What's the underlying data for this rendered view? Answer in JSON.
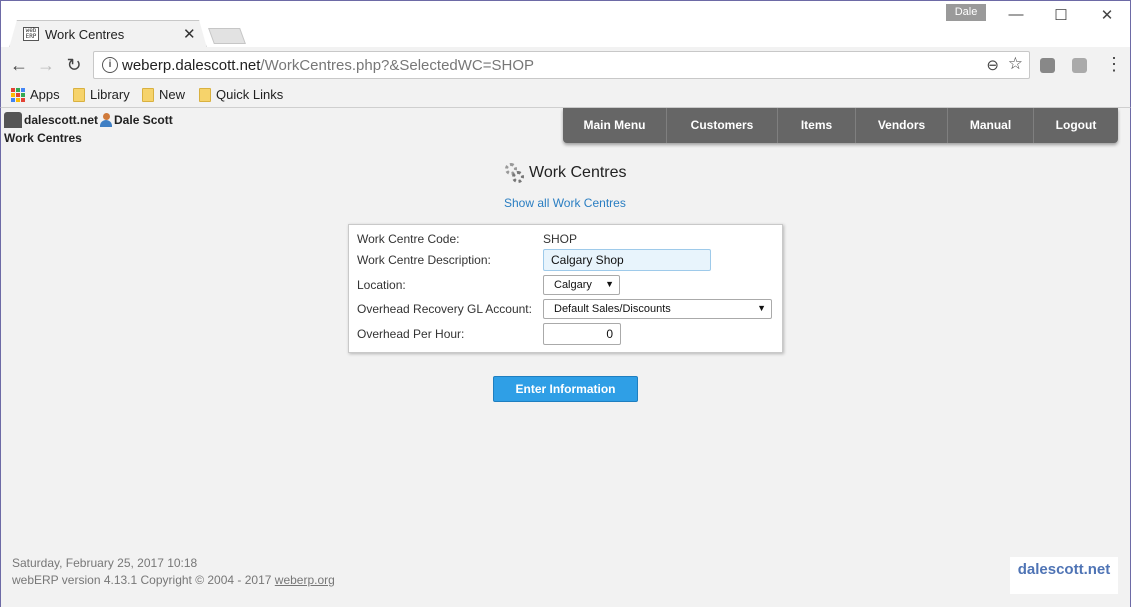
{
  "browser": {
    "tab_title": "Work Centres",
    "tab_favicon_text": "web ERP",
    "user_chip": "Dale",
    "url_host": "weberp.dalescott.net",
    "url_path": "/WorkCentres.php?&SelectedWC=SHOP",
    "bookmarks": [
      "Apps",
      "Library",
      "New",
      "Quick Links"
    ]
  },
  "header": {
    "company": "dalescott.net",
    "user": "Dale Scott",
    "breadcrumb": "Work Centres",
    "menu": [
      "Main Menu",
      "Customers",
      "Items",
      "Vendors",
      "Manual",
      "Logout"
    ]
  },
  "main": {
    "title": "Work Centres",
    "show_all_link": "Show all Work Centres",
    "form": {
      "code_label": "Work Centre Code:",
      "code_value": "SHOP",
      "description_label": "Work Centre Description:",
      "description_value": "Calgary Shop",
      "location_label": "Location:",
      "location_value": "Calgary",
      "gl_label": "Overhead Recovery GL Account:",
      "gl_value": "Default Sales/Discounts",
      "overhead_label": "Overhead Per Hour:",
      "overhead_value": "0"
    },
    "submit_label": "Enter Information"
  },
  "footer": {
    "datetime": "Saturday, February 25, 2017 10:18",
    "copyright": "webERP version 4.13.1 Copyright © 2004 - 2017",
    "link": "weberp.org",
    "logo_text": "dalescott.net"
  },
  "colors": {
    "menu_bg": "#666666",
    "link": "#2a7ec2",
    "button": "#2f9fe6",
    "window_border": "#6d6aa6"
  }
}
